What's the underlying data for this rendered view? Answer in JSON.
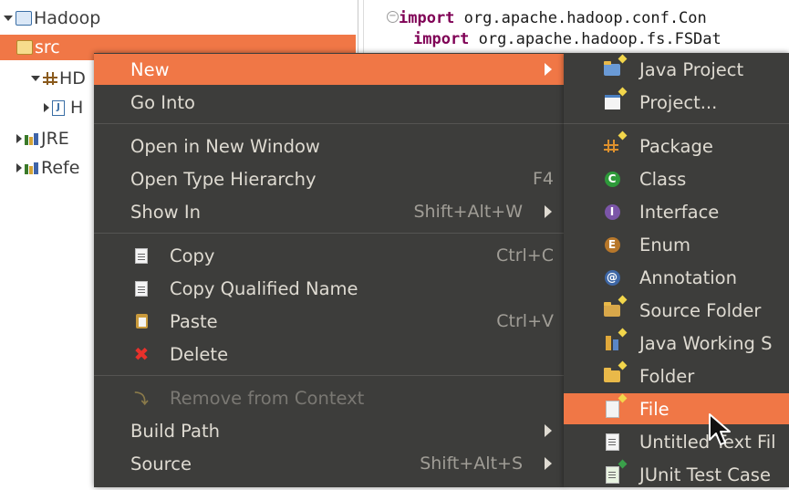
{
  "tree": {
    "items": [
      {
        "label": "Hadoop"
      },
      {
        "label": "src"
      },
      {
        "label": "HD"
      },
      {
        "label": "H"
      },
      {
        "label": "JRE"
      },
      {
        "label": "Refe"
      }
    ]
  },
  "editor": {
    "lines": [
      {
        "keyword": "import",
        "text": " org.apache.hadoop.conf.Con"
      },
      {
        "keyword": "import",
        "text": " org.apache.hadoop.fs.FSDat"
      }
    ]
  },
  "context_menu": {
    "new": "New",
    "go_into": "Go Into",
    "open_new_window": "Open in New Window",
    "open_type_hierarchy": "Open Type Hierarchy",
    "open_type_hierarchy_shortcut": "F4",
    "show_in": "Show In",
    "show_in_shortcut": "Shift+Alt+W",
    "copy": "Copy",
    "copy_shortcut": "Ctrl+C",
    "copy_qualified": "Copy Qualified Name",
    "paste": "Paste",
    "paste_shortcut": "Ctrl+V",
    "delete": "Delete",
    "remove_from_context": "Remove from Context",
    "build_path": "Build Path",
    "source": "Source",
    "source_shortcut": "Shift+Alt+S"
  },
  "new_submenu": {
    "java_project": "Java Project",
    "project": "Project...",
    "package": "Package",
    "class": "Class",
    "interface": "Interface",
    "enum": "Enum",
    "annotation": "Annotation",
    "source_folder": "Source Folder",
    "java_working_set": "Java Working S",
    "folder": "Folder",
    "file": "File",
    "untitled_text_file": "Untitled Text Fil",
    "junit_test_case": "JUnit Test Case"
  },
  "colors": {
    "selection": "#f07746",
    "menu_background": "#3d3d3b",
    "keyword": "#7f0055"
  }
}
